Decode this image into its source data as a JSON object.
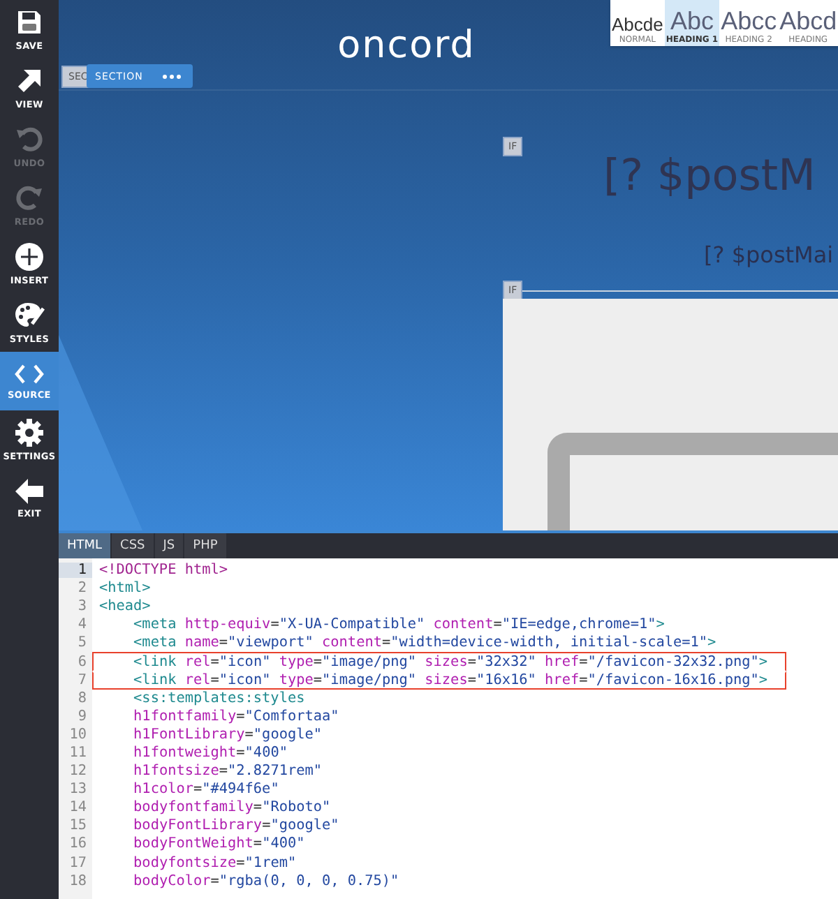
{
  "sidebar": {
    "items": [
      {
        "label": "SAVE",
        "kind": "save",
        "disabled": false,
        "selected": false
      },
      {
        "label": "VIEW",
        "kind": "view",
        "disabled": false,
        "selected": false
      },
      {
        "label": "UNDO",
        "kind": "undo",
        "disabled": true,
        "selected": false
      },
      {
        "label": "REDO",
        "kind": "redo",
        "disabled": true,
        "selected": false
      },
      {
        "label": "INSERT",
        "kind": "insert",
        "disabled": false,
        "selected": false
      },
      {
        "label": "STYLES",
        "kind": "styles",
        "disabled": false,
        "selected": false
      },
      {
        "label": "SOURCE",
        "kind": "source",
        "disabled": false,
        "selected": true
      },
      {
        "label": "SETTINGS",
        "kind": "settings",
        "disabled": false,
        "selected": false
      },
      {
        "label": "EXIT",
        "kind": "exit",
        "disabled": false,
        "selected": false
      }
    ]
  },
  "canvas": {
    "logo": "oncord",
    "behind_tag": "SEC",
    "section_tag": "SECTION",
    "if_tags": [
      "IF",
      "IF"
    ],
    "heading": "[? $postM",
    "subheading": "[? $postMai"
  },
  "style_picker": [
    {
      "preview": "Abcde",
      "label": "NORMAL",
      "kind": "normal",
      "selected": false
    },
    {
      "preview": "Abc",
      "label": "HEADING 1",
      "kind": "heading",
      "selected": true
    },
    {
      "preview": "Abcc",
      "label": "HEADING 2",
      "kind": "heading",
      "selected": false
    },
    {
      "preview": "Abcd",
      "label": "HEADING",
      "kind": "heading",
      "selected": false
    }
  ],
  "editor": {
    "tabs": [
      {
        "label": "HTML",
        "selected": true
      },
      {
        "label": "CSS",
        "selected": false
      },
      {
        "label": "JS",
        "selected": false
      },
      {
        "label": "PHP",
        "selected": false
      }
    ],
    "lines": [
      {
        "number": "1",
        "active": true,
        "boxed": false,
        "text": "<!DOCTYPE html>"
      },
      {
        "number": "2",
        "active": false,
        "boxed": false,
        "text": "<html>"
      },
      {
        "number": "3",
        "active": false,
        "boxed": false,
        "text": "<head>"
      },
      {
        "number": "4",
        "active": false,
        "boxed": false,
        "text": "    <meta http-equiv=\"X-UA-Compatible\" content=\"IE=edge,chrome=1\">"
      },
      {
        "number": "5",
        "active": false,
        "boxed": false,
        "text": "    <meta name=\"viewport\" content=\"width=device-width, initial-scale=1\">"
      },
      {
        "number": "6",
        "active": false,
        "boxed": true,
        "text": "    <link rel=\"icon\" type=\"image/png\" sizes=\"32x32\" href=\"/favicon-32x32.png\">"
      },
      {
        "number": "7",
        "active": false,
        "boxed": true,
        "text": "    <link rel=\"icon\" type=\"image/png\" sizes=\"16x16\" href=\"/favicon-16x16.png\">"
      },
      {
        "number": "8",
        "active": false,
        "boxed": false,
        "text": "    <ss:templates:styles"
      },
      {
        "number": "9",
        "active": false,
        "boxed": false,
        "text": "    h1fontfamily=\"Comfortaa\""
      },
      {
        "number": "10",
        "active": false,
        "boxed": false,
        "text": "    h1FontLibrary=\"google\""
      },
      {
        "number": "11",
        "active": false,
        "boxed": false,
        "text": "    h1fontweight=\"400\""
      },
      {
        "number": "12",
        "active": false,
        "boxed": false,
        "text": "    h1fontsize=\"2.8271rem\""
      },
      {
        "number": "13",
        "active": false,
        "boxed": false,
        "text": "    h1color=\"#494f6e\""
      },
      {
        "number": "14",
        "active": false,
        "boxed": false,
        "text": "    bodyfontfamily=\"Roboto\""
      },
      {
        "number": "15",
        "active": false,
        "boxed": false,
        "text": "    bodyFontLibrary=\"google\""
      },
      {
        "number": "16",
        "active": false,
        "boxed": false,
        "text": "    bodyFontWeight=\"400\""
      },
      {
        "number": "17",
        "active": false,
        "boxed": false,
        "text": "    bodyfontsize=\"1rem\""
      },
      {
        "number": "18",
        "active": false,
        "boxed": false,
        "text": "    bodyColor=\"rgba(0, 0, 0, 0.75)\""
      }
    ]
  }
}
